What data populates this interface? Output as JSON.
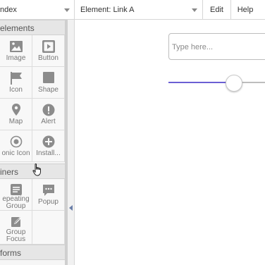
{
  "topbar": {
    "page_label": "ndex",
    "element_label": "Element: Link A",
    "edit_label": "Edit",
    "help_label": "Help"
  },
  "palette": {
    "sections": [
      {
        "title": "elements"
      },
      {
        "title": "iners"
      },
      {
        "title": "forms"
      }
    ],
    "items": [
      {
        "label": "Image",
        "icon": "image-icon"
      },
      {
        "label": "Button",
        "icon": "button-icon"
      },
      {
        "label": "Icon",
        "icon": "flag-icon"
      },
      {
        "label": "Shape",
        "icon": "square-icon"
      },
      {
        "label": "Map",
        "icon": "map-pin-icon"
      },
      {
        "label": "Alert",
        "icon": "alert-icon"
      },
      {
        "label": "onic Icon",
        "icon": "ionic-icon"
      },
      {
        "label": "Install...",
        "icon": "plus-circle-icon"
      },
      {
        "label_line1": "epeating",
        "label_line2": "Group",
        "icon": "list-icon"
      },
      {
        "label": "Popup",
        "icon": "chat-icon"
      },
      {
        "label_line1": "Group",
        "label_line2": "Focus",
        "icon": "edit-icon"
      }
    ]
  },
  "canvas": {
    "input_placeholder": "Type here...",
    "slider_value_fraction": 0.58
  },
  "colors": {
    "slider_fill": "#6b5fd4",
    "palette_bg": "#f6f6f6",
    "section_bg": "#e6e6e6",
    "icon_gray": "#8c8c8c"
  }
}
